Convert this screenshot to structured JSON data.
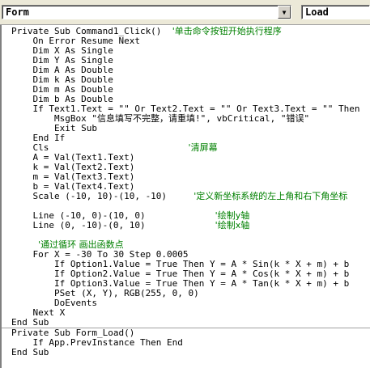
{
  "object_combo": {
    "value": "Form"
  },
  "procedure_combo": {
    "value": "Load"
  },
  "code": {
    "proc1": [
      {
        "code": "Private Sub Command1_Click()",
        "indent": 0,
        "comment": "'单击命令按钮开始执行程序",
        "gap": 2
      },
      {
        "code": "On Error Resume Next",
        "indent": 4
      },
      {
        "code": "Dim X As Single",
        "indent": 4
      },
      {
        "code": "Dim Y As Single",
        "indent": 4
      },
      {
        "code": "Dim A As Double",
        "indent": 4
      },
      {
        "code": "Dim k As Double",
        "indent": 4
      },
      {
        "code": "Dim m As Double",
        "indent": 4
      },
      {
        "code": "Dim b As Double",
        "indent": 4
      },
      {
        "code": "If Text1.Text = \"\" Or Text2.Text = \"\" Or Text3.Text = \"\" Then",
        "indent": 4
      },
      {
        "code": "MsgBox \"信息填写不完整，请重填!\", vbCritical, \"错误\"",
        "indent": 8
      },
      {
        "code": "Exit Sub",
        "indent": 8
      },
      {
        "code": "End If",
        "indent": 4
      },
      {
        "code": "Cls",
        "indent": 4,
        "comment": "'清屏幕",
        "gap": 26
      },
      {
        "code": "A = Val(Text1.Text)",
        "indent": 4
      },
      {
        "code": "k = Val(Text2.Text)",
        "indent": 4
      },
      {
        "code": "m = Val(Text3.Text)",
        "indent": 4
      },
      {
        "code": "b = Val(Text4.Text)",
        "indent": 4
      },
      {
        "code": "Scale (-10, 10)-(10, -10)",
        "indent": 4,
        "comment": "'定义新坐标系统的左上角和右下角坐标",
        "gap": 5
      },
      {
        "code": "",
        "indent": 0
      },
      {
        "code": "Line (-10, 0)-(10, 0)",
        "indent": 4,
        "comment": "'绘制y轴",
        "gap": 13
      },
      {
        "code": "Line (0, -10)-(0, 10)",
        "indent": 4,
        "comment": "'绘制x轴",
        "gap": 13
      },
      {
        "code": "",
        "indent": 0
      },
      {
        "code": "",
        "indent": 4,
        "comment": "'通过循环 画出函数点",
        "gap": 0
      },
      {
        "code": "For X = -30 To 30 Step 0.0005",
        "indent": 4
      },
      {
        "code": "If Option1.Value = True Then Y = A * Sin(k * X + m) + b",
        "indent": 8
      },
      {
        "code": "If Option2.Value = True Then Y = A * Cos(k * X + m) + b",
        "indent": 8
      },
      {
        "code": "If Option3.Value = True Then Y = A * Tan(k * X + m) + b",
        "indent": 8
      },
      {
        "code": "PSet (X, Y), RGB(255, 0, 0)",
        "indent": 8
      },
      {
        "code": "DoEvents",
        "indent": 8
      },
      {
        "code": "Next X",
        "indent": 4
      },
      {
        "code": "End Sub",
        "indent": 0
      }
    ],
    "proc2": [
      {
        "code": "Private Sub Form_Load()",
        "indent": 0
      },
      {
        "code": "If App.PrevInstance Then End",
        "indent": 4
      },
      {
        "code": "End Sub",
        "indent": 0
      }
    ]
  }
}
